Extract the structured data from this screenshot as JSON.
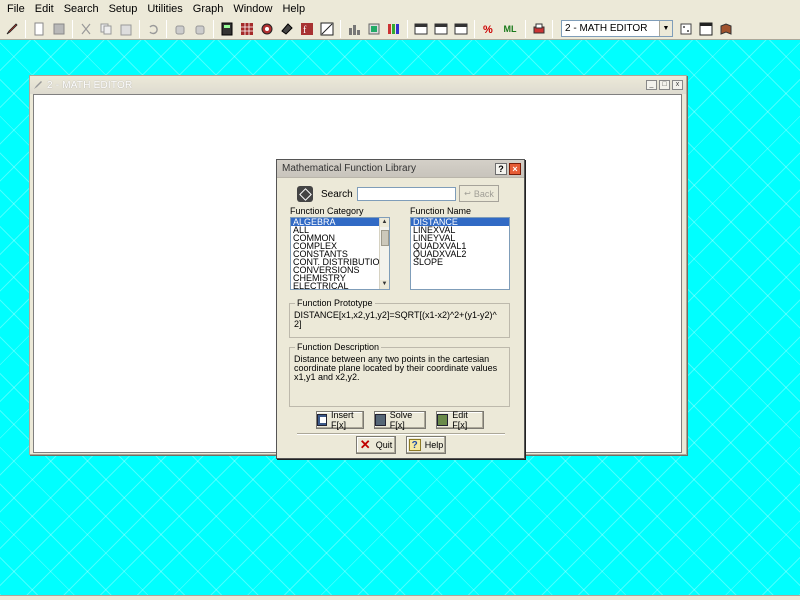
{
  "menubar": {
    "items": [
      {
        "label": "File"
      },
      {
        "label": "Edit"
      },
      {
        "label": "Search"
      },
      {
        "label": "Setup"
      },
      {
        "label": "Utilities"
      },
      {
        "label": "Graph"
      },
      {
        "label": "Window"
      },
      {
        "label": "Help"
      }
    ]
  },
  "toolbar": {
    "editor_select": "2 - MATH EDITOR",
    "icons": [
      "pen-icon",
      "new-icon",
      "save-icon",
      "cut-icon",
      "copy-icon",
      "paste-icon",
      "undo-icon",
      "hand-icon",
      "hand-icon",
      "calculator-icon",
      "grid-icon",
      "settings-icon",
      "eraser-icon",
      "function-icon",
      "graph-icon",
      "chart-icon",
      "print-preview-icon",
      "report-icon",
      "book-icon",
      "window-icon",
      "window-icon",
      "window-icon",
      "percent-icon",
      "ml-icon",
      "printer-icon"
    ],
    "ml_label": "ML"
  },
  "child_window": {
    "title": "2 - MATH EDITOR"
  },
  "dialog": {
    "title": "Mathematical Function Library",
    "search_label": "Search",
    "search_value": "",
    "back_label": "Back",
    "category_label": "Function Category",
    "categories": [
      "ALGEBRA",
      "ALL",
      "COMMON",
      "COMPLEX",
      "CONSTANTS",
      "CONT. DISTRIBUTIONS",
      "CONVERSIONS",
      "CHEMISTRY",
      "ELECTRICAL"
    ],
    "selected_category": "ALGEBRA",
    "name_label": "Function Name",
    "names": [
      "DISTANCE",
      "LINEXVAL",
      "LINEYVAL",
      "QUADXVAL1",
      "QUADXVAL2",
      "SLOPE"
    ],
    "selected_name": "DISTANCE",
    "prototype_title": "Function Prototype",
    "prototype_text": "DISTANCE[x1,x2,y1,y2]=SQRT[(x1-x2)^2+(y1-y2)^ 2]",
    "description_title": "Function Description",
    "description_text": "Distance between any two points in the cartesian coordinate plane located by their coordinate values x1,y1 and x2,y2.",
    "buttons": {
      "insert": "Insert F[x]",
      "solve": "Solve F[x]",
      "edit": "Edit F[x]",
      "quit": "Quit",
      "help": "Help"
    }
  }
}
